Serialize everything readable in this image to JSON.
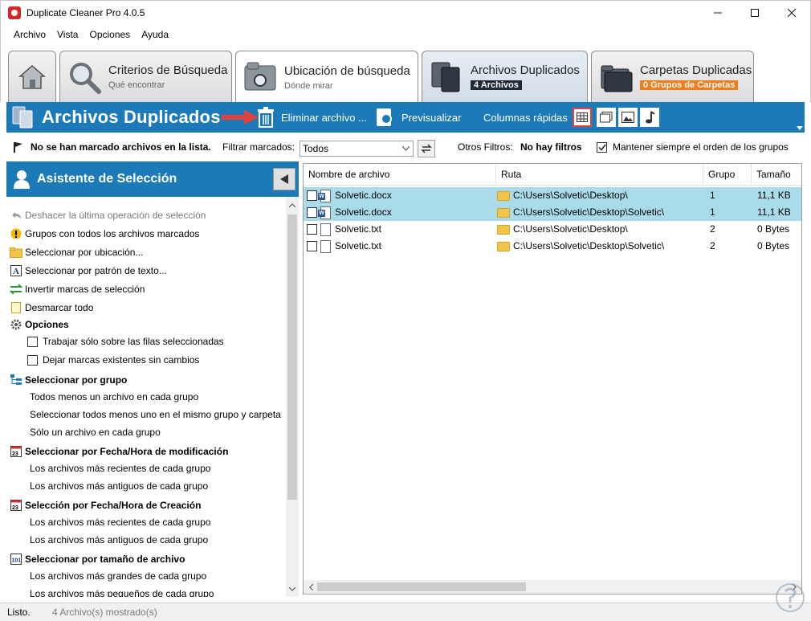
{
  "window": {
    "title": "Duplicate Cleaner Pro 4.0.5"
  },
  "menu": [
    "Archivo",
    "Vista",
    "Opciones",
    "Ayuda"
  ],
  "tabs": [
    {
      "title": "Criterios de Búsqueda",
      "sub": "Qué encontrar"
    },
    {
      "title": "Ubicación de búsqueda",
      "sub": "Dónde mirar"
    },
    {
      "title": "Archivos Duplicados",
      "badge": "4 Archivos",
      "badge_color": "#1e2a36"
    },
    {
      "title": "Carpetas Duplicadas",
      "badge": "0 Grupos de Carpetas",
      "badge_color": "#f07c1c"
    }
  ],
  "header": {
    "title": "Archivos Duplicados",
    "delete_label": "Eliminar archivo ...",
    "preview_label": "Previsualizar",
    "quick_columns_label": "Columnas rápidas"
  },
  "filter_row": {
    "no_marked": "No se han marcado archivos en la lista.",
    "filter_label": "Filtrar marcados:",
    "filter_value": "Todos",
    "other_filters_label": "Otros Filtros:",
    "other_filters_value": "No hay filtros",
    "keep_order_label": "Mantener siempre el orden de los grupos",
    "keep_order_checked": true
  },
  "assistant": {
    "title": "Asistente de Selección",
    "items": {
      "undo": "Deshacer la última operación de selección",
      "groups_all_marked": "Grupos con todos los archivos marcados",
      "by_location": "Seleccionar por ubicación...",
      "by_text": "Seleccionar por patrón de texto...",
      "invert": "Invertir marcas de selección",
      "unmark_all": "Desmarcar todo",
      "options": "Opciones",
      "only_selected_rows": "Trabajar sólo sobre las filas seleccionadas",
      "keep_existing": "Dejar marcas existentes sin cambios",
      "by_group": "Seleccionar por grupo",
      "all_but_one": "Todos menos un archivo en cada grupo",
      "all_but_one_same_folder": "Seleccionar todos menos uno en el mismo grupo y carpeta",
      "only_one": "Sólo un archivo en cada grupo",
      "by_mod_date": "Seleccionar por Fecha/Hora de modificación",
      "mod_newest": "Los archivos más recientes de cada grupo",
      "mod_oldest": "Los archivos más antiguos de cada grupo",
      "by_create_date": "Selección por Fecha/Hora de Creación",
      "create_newest": "Los archivos más recientes de cada grupo",
      "create_oldest": "Los archivos más antiguos de cada grupo",
      "by_size": "Seleccionar por tamaño de archivo",
      "size_largest": "Los archivos más grandes de cada grupo",
      "size_smallest": "Los archivos más pequeños de cada grupo"
    }
  },
  "table": {
    "columns": [
      "Nombre de archivo",
      "Ruta",
      "Grupo",
      "Tamaño"
    ],
    "rows": [
      {
        "name": "Solvetic.docx",
        "path": "C:\\Users\\Solvetic\\Desktop\\",
        "group": "1",
        "size": "11,1 KB",
        "type": "word",
        "selected": true
      },
      {
        "name": "Solvetic.docx",
        "path": "C:\\Users\\Solvetic\\Desktop\\Solvetic\\",
        "group": "1",
        "size": "11,1 KB",
        "type": "word",
        "selected": true
      },
      {
        "name": "Solvetic.txt",
        "path": "C:\\Users\\Solvetic\\Desktop\\",
        "group": "2",
        "size": "0 Bytes",
        "type": "text",
        "selected": false
      },
      {
        "name": "Solvetic.txt",
        "path": "C:\\Users\\Solvetic\\Desktop\\Solvetic\\",
        "group": "2",
        "size": "0 Bytes",
        "type": "text",
        "selected": false
      }
    ]
  },
  "status": {
    "ready": "Listo.",
    "count": "4 Archivo(s) mostrado(s)"
  },
  "colors": {
    "header_blue": "#1c7ab9",
    "row_selected": "#a9dbe8",
    "arrow_red": "#e34040"
  }
}
